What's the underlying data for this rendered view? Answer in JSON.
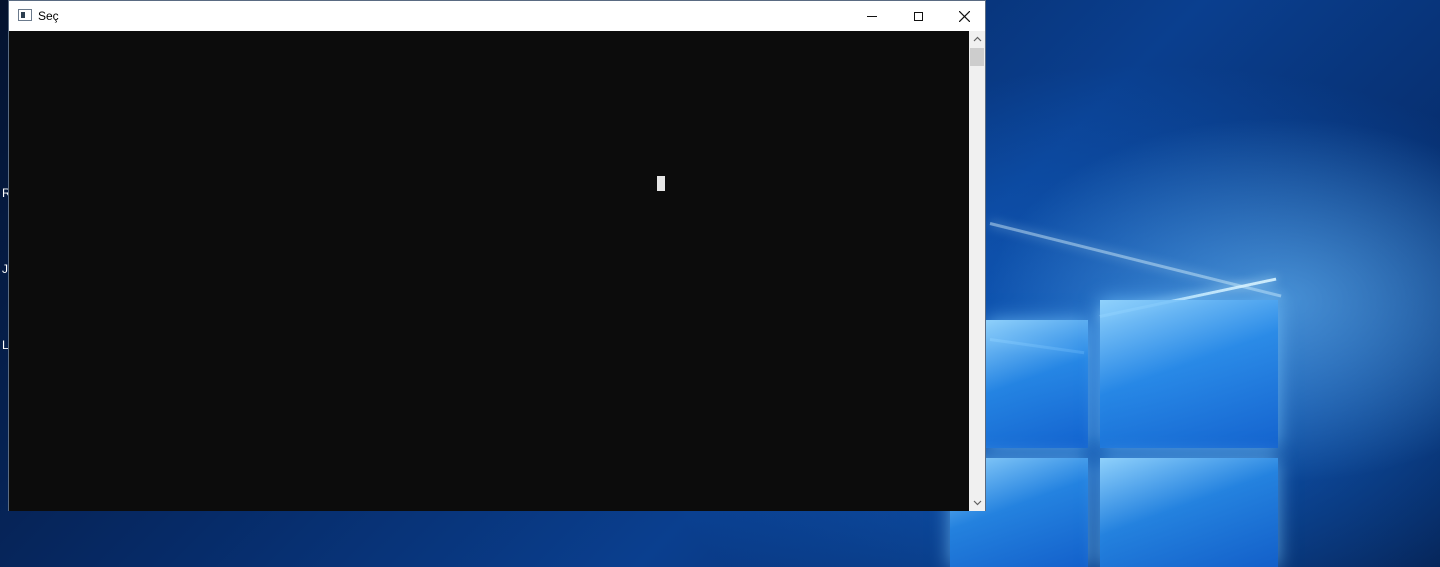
{
  "window": {
    "title": "Seç",
    "icon": "console-app-icon",
    "controls": {
      "minimize": "minimize-icon",
      "maximize": "maximize-icon",
      "close": "close-icon"
    }
  },
  "console": {
    "background": "#0c0c0c",
    "cursor_color": "#e6e6e6"
  },
  "desktop": {
    "side_glyphs": [
      "R",
      "J",
      "L"
    ],
    "accent": "#0a3f8f"
  }
}
